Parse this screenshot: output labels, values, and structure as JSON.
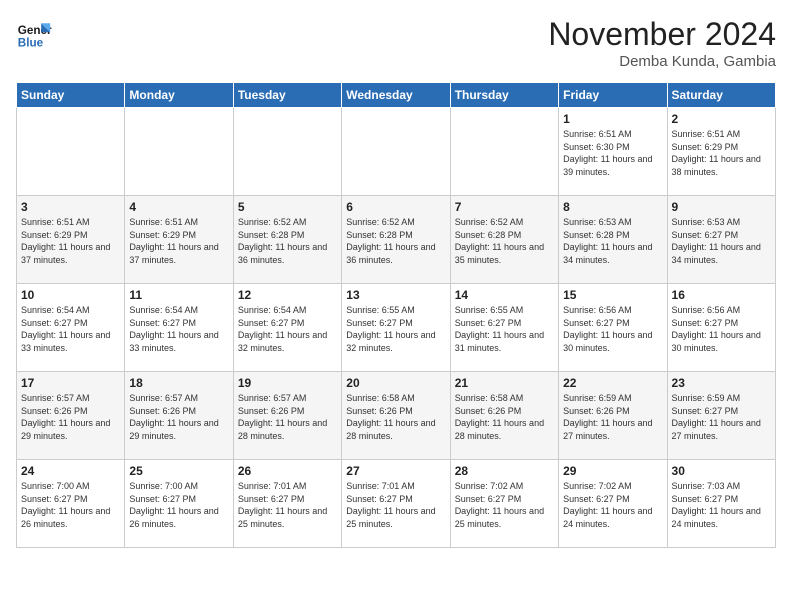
{
  "logo": {
    "line1": "General",
    "line2": "Blue"
  },
  "title": "November 2024",
  "subtitle": "Demba Kunda, Gambia",
  "days_of_week": [
    "Sunday",
    "Monday",
    "Tuesday",
    "Wednesday",
    "Thursday",
    "Friday",
    "Saturday"
  ],
  "weeks": [
    [
      {
        "day": "",
        "info": ""
      },
      {
        "day": "",
        "info": ""
      },
      {
        "day": "",
        "info": ""
      },
      {
        "day": "",
        "info": ""
      },
      {
        "day": "",
        "info": ""
      },
      {
        "day": "1",
        "info": "Sunrise: 6:51 AM\nSunset: 6:30 PM\nDaylight: 11 hours and 39 minutes."
      },
      {
        "day": "2",
        "info": "Sunrise: 6:51 AM\nSunset: 6:29 PM\nDaylight: 11 hours and 38 minutes."
      }
    ],
    [
      {
        "day": "3",
        "info": "Sunrise: 6:51 AM\nSunset: 6:29 PM\nDaylight: 11 hours and 37 minutes."
      },
      {
        "day": "4",
        "info": "Sunrise: 6:51 AM\nSunset: 6:29 PM\nDaylight: 11 hours and 37 minutes."
      },
      {
        "day": "5",
        "info": "Sunrise: 6:52 AM\nSunset: 6:28 PM\nDaylight: 11 hours and 36 minutes."
      },
      {
        "day": "6",
        "info": "Sunrise: 6:52 AM\nSunset: 6:28 PM\nDaylight: 11 hours and 36 minutes."
      },
      {
        "day": "7",
        "info": "Sunrise: 6:52 AM\nSunset: 6:28 PM\nDaylight: 11 hours and 35 minutes."
      },
      {
        "day": "8",
        "info": "Sunrise: 6:53 AM\nSunset: 6:28 PM\nDaylight: 11 hours and 34 minutes."
      },
      {
        "day": "9",
        "info": "Sunrise: 6:53 AM\nSunset: 6:27 PM\nDaylight: 11 hours and 34 minutes."
      }
    ],
    [
      {
        "day": "10",
        "info": "Sunrise: 6:54 AM\nSunset: 6:27 PM\nDaylight: 11 hours and 33 minutes."
      },
      {
        "day": "11",
        "info": "Sunrise: 6:54 AM\nSunset: 6:27 PM\nDaylight: 11 hours and 33 minutes."
      },
      {
        "day": "12",
        "info": "Sunrise: 6:54 AM\nSunset: 6:27 PM\nDaylight: 11 hours and 32 minutes."
      },
      {
        "day": "13",
        "info": "Sunrise: 6:55 AM\nSunset: 6:27 PM\nDaylight: 11 hours and 32 minutes."
      },
      {
        "day": "14",
        "info": "Sunrise: 6:55 AM\nSunset: 6:27 PM\nDaylight: 11 hours and 31 minutes."
      },
      {
        "day": "15",
        "info": "Sunrise: 6:56 AM\nSunset: 6:27 PM\nDaylight: 11 hours and 30 minutes."
      },
      {
        "day": "16",
        "info": "Sunrise: 6:56 AM\nSunset: 6:27 PM\nDaylight: 11 hours and 30 minutes."
      }
    ],
    [
      {
        "day": "17",
        "info": "Sunrise: 6:57 AM\nSunset: 6:26 PM\nDaylight: 11 hours and 29 minutes."
      },
      {
        "day": "18",
        "info": "Sunrise: 6:57 AM\nSunset: 6:26 PM\nDaylight: 11 hours and 29 minutes."
      },
      {
        "day": "19",
        "info": "Sunrise: 6:57 AM\nSunset: 6:26 PM\nDaylight: 11 hours and 28 minutes."
      },
      {
        "day": "20",
        "info": "Sunrise: 6:58 AM\nSunset: 6:26 PM\nDaylight: 11 hours and 28 minutes."
      },
      {
        "day": "21",
        "info": "Sunrise: 6:58 AM\nSunset: 6:26 PM\nDaylight: 11 hours and 28 minutes."
      },
      {
        "day": "22",
        "info": "Sunrise: 6:59 AM\nSunset: 6:26 PM\nDaylight: 11 hours and 27 minutes."
      },
      {
        "day": "23",
        "info": "Sunrise: 6:59 AM\nSunset: 6:27 PM\nDaylight: 11 hours and 27 minutes."
      }
    ],
    [
      {
        "day": "24",
        "info": "Sunrise: 7:00 AM\nSunset: 6:27 PM\nDaylight: 11 hours and 26 minutes."
      },
      {
        "day": "25",
        "info": "Sunrise: 7:00 AM\nSunset: 6:27 PM\nDaylight: 11 hours and 26 minutes."
      },
      {
        "day": "26",
        "info": "Sunrise: 7:01 AM\nSunset: 6:27 PM\nDaylight: 11 hours and 25 minutes."
      },
      {
        "day": "27",
        "info": "Sunrise: 7:01 AM\nSunset: 6:27 PM\nDaylight: 11 hours and 25 minutes."
      },
      {
        "day": "28",
        "info": "Sunrise: 7:02 AM\nSunset: 6:27 PM\nDaylight: 11 hours and 25 minutes."
      },
      {
        "day": "29",
        "info": "Sunrise: 7:02 AM\nSunset: 6:27 PM\nDaylight: 11 hours and 24 minutes."
      },
      {
        "day": "30",
        "info": "Sunrise: 7:03 AM\nSunset: 6:27 PM\nDaylight: 11 hours and 24 minutes."
      }
    ]
  ]
}
